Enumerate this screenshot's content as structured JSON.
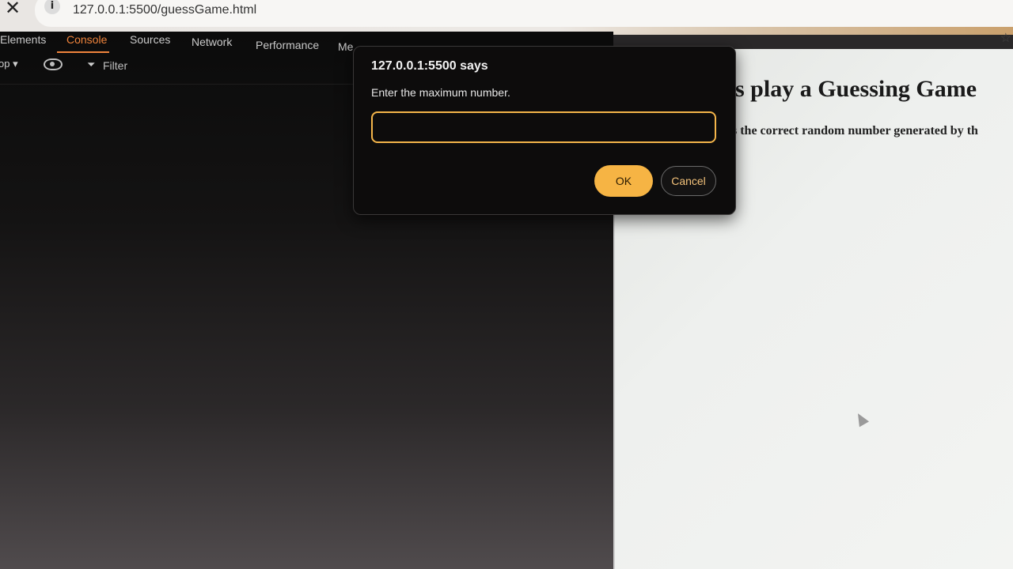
{
  "browser": {
    "url": "127.0.0.1:5500/guessGame.html",
    "close_symbol": "✕",
    "info_symbol": "i"
  },
  "devtools": {
    "tabs": [
      "Elements",
      "Console",
      "Sources",
      "Network",
      "Performance",
      "Me"
    ],
    "active_tab": "Console",
    "context_label": "op ▾",
    "filter_label": "Filter",
    "filter_icon": "filter-icon",
    "eye_icon": "eye-icon"
  },
  "page": {
    "heading": "s play a Guessing Game",
    "subtext": "s the correct random number generated by th"
  },
  "dialog": {
    "title": "127.0.0.1:5500 says",
    "message": "Enter the maximum number.",
    "input_value": "",
    "ok_label": "OK",
    "cancel_label": "Cancel"
  },
  "colors": {
    "accent": "#f6b444",
    "active_tab": "#f0843c",
    "dialog_bg": "#0d0c0c"
  }
}
